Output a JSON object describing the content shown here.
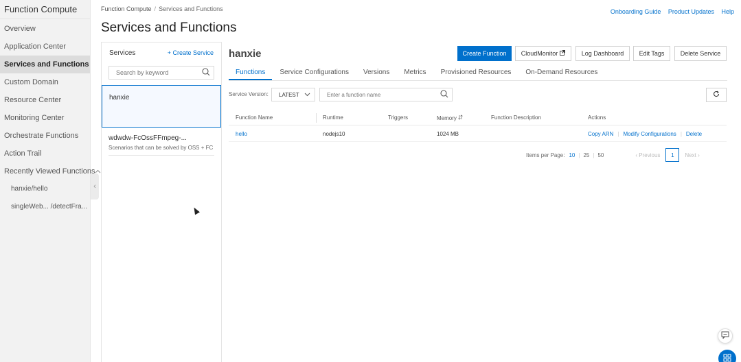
{
  "sidebar": {
    "title": "Function Compute",
    "items": [
      {
        "label": "Overview"
      },
      {
        "label": "Application Center"
      },
      {
        "label": "Services and Functions"
      },
      {
        "label": "Custom Domain"
      },
      {
        "label": "Resource Center"
      },
      {
        "label": "Monitoring Center"
      },
      {
        "label": "Orchestrate Functions"
      },
      {
        "label": "Action Trail"
      }
    ],
    "recent_label": "Recently Viewed Functions",
    "recent": [
      {
        "label": "hanxie/hello"
      },
      {
        "label": "singleWeb... /detectFra..."
      }
    ]
  },
  "breadcrumb": {
    "root": "Function Compute",
    "separator": "/",
    "current": "Services and Functions"
  },
  "top_links": {
    "guide": "Onboarding Guide",
    "updates": "Product Updates",
    "help": "Help"
  },
  "page_title": "Services and Functions",
  "services_panel": {
    "title": "Services",
    "create": "+ Create Service",
    "search_placeholder": "Search by keyword",
    "services": [
      {
        "name": "hanxie",
        "description": ""
      },
      {
        "name": "wdwdw-FcOssFFmpeg-...",
        "description": "Scenarios that can be solved by OSS + FC"
      }
    ]
  },
  "main": {
    "service_title": "hanxie",
    "buttons": {
      "create_function": "Create Function",
      "cloud_monitor": "CloudMonitor",
      "log_dashboard": "Log Dashboard",
      "edit_tags": "Edit Tags",
      "delete_service": "Delete Service"
    },
    "tabs": [
      {
        "label": "Functions"
      },
      {
        "label": "Service Configurations"
      },
      {
        "label": "Versions"
      },
      {
        "label": "Metrics"
      },
      {
        "label": "Provisioned Resources"
      },
      {
        "label": "On-Demand Resources"
      }
    ],
    "version_label": "Service Version:",
    "version_value": "LATEST",
    "function_search_placeholder": "Enter a function name",
    "table": {
      "headers": {
        "name": "Function Name",
        "runtime": "Runtime",
        "triggers": "Triggers",
        "memory": "Memory",
        "description": "Function Description",
        "actions": "Actions"
      },
      "rows": [
        {
          "name": "hello",
          "runtime": "nodejs10",
          "triggers": "",
          "memory": "1024 MB",
          "description": "",
          "actions": {
            "copy_arn": "Copy ARN",
            "modify": "Modify Configurations",
            "delete": "Delete"
          }
        }
      ]
    },
    "pagination": {
      "items_per_page_label": "Items per Page:",
      "sizes": [
        "10",
        "25",
        "50"
      ],
      "selected_size": "10",
      "prev": "Previous",
      "next": "Next",
      "current_page": "1"
    }
  },
  "colors": {
    "accent": "#0070cc",
    "sidebar_bg": "#f2f2f2",
    "active_item_bg": "#dcdcdc"
  }
}
